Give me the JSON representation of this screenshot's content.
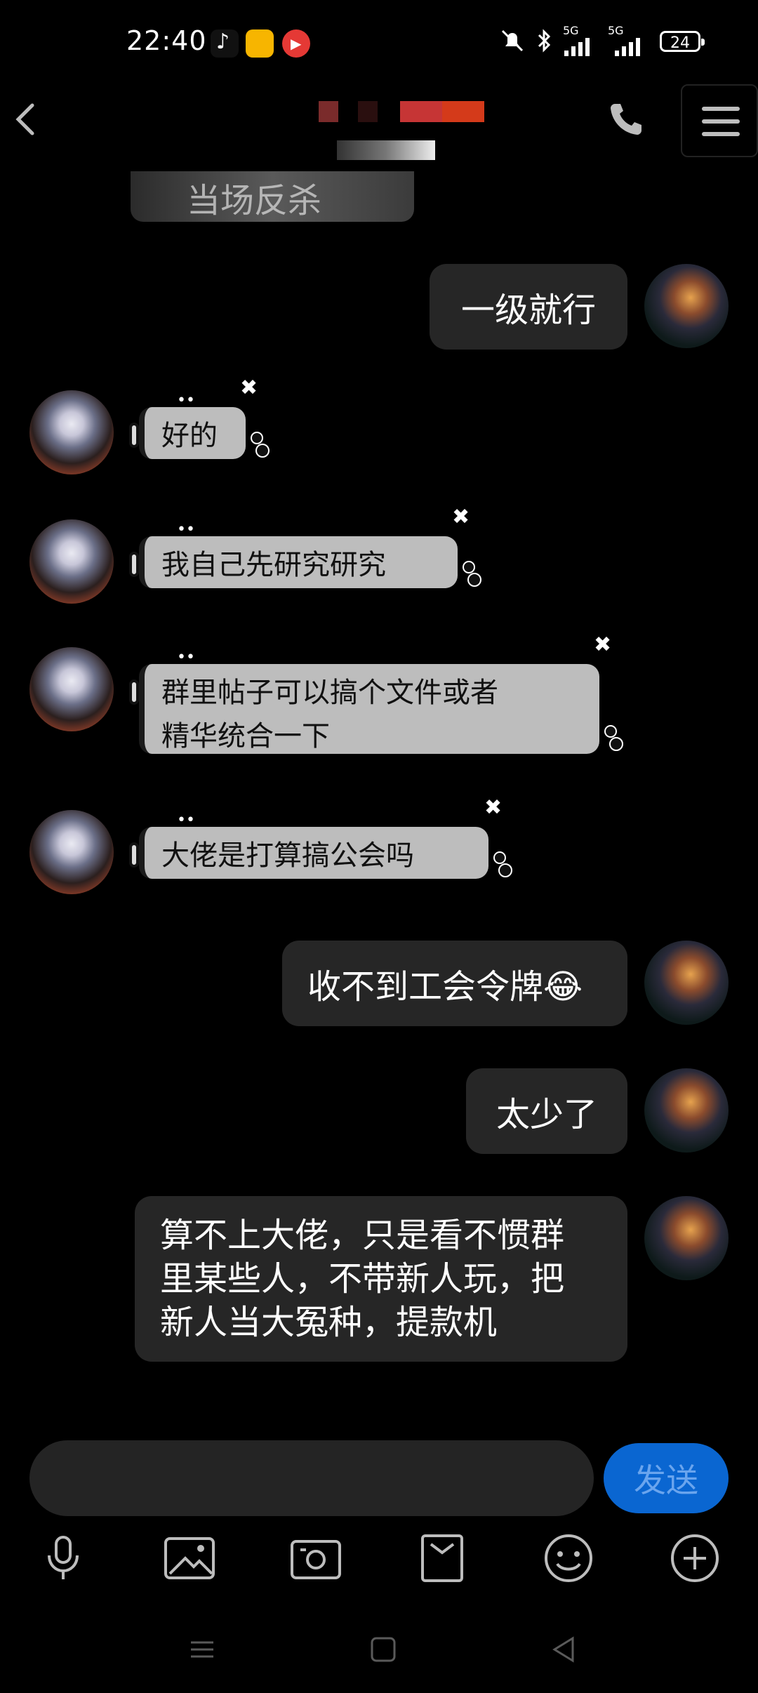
{
  "status_bar": {
    "time": "22:40",
    "battery": "24",
    "signal_1": "5G",
    "signal_2": "5G"
  },
  "header": {
    "title": "",
    "subtitle": ""
  },
  "image_snippet": {
    "caption": "当场反杀"
  },
  "messages": [
    {
      "side": "right",
      "text": "一级就行"
    },
    {
      "side": "left",
      "text": "好的"
    },
    {
      "side": "left",
      "text": "我自己先研究研究"
    },
    {
      "side": "left",
      "line1": "群里帖子可以搞个文件或者",
      "line2": "精华统合一下"
    },
    {
      "side": "left",
      "text": "大佬是打算搞公会吗"
    },
    {
      "side": "right",
      "text": "收不到工会令牌😂"
    },
    {
      "side": "right",
      "text": "太少了"
    },
    {
      "side": "right",
      "line1": "算不上大佬，只是看不惯群",
      "line2": "里某些人，不带新人玩，把",
      "line3": "新人当大冤种，提款机"
    }
  ],
  "input": {
    "placeholder": "",
    "send_label": "发送"
  },
  "colors": {
    "background": "#000000",
    "bubble_dark": "#262626",
    "bubble_light": "#bdbdbd",
    "send_blue": "#0a66d1"
  },
  "icons": [
    "back-icon",
    "phone-icon",
    "menu-icon",
    "mic-icon",
    "image-icon",
    "camera-icon",
    "file-icon",
    "emoji-icon",
    "plus-icon"
  ]
}
